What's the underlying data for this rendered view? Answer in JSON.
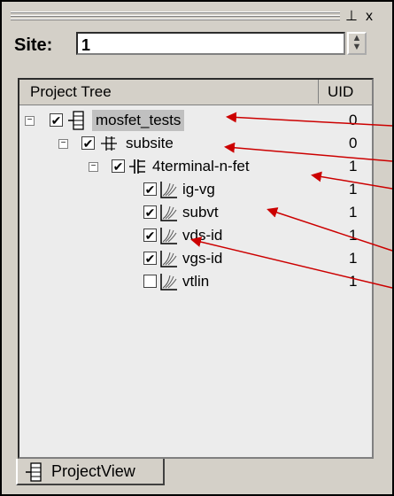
{
  "window": {
    "pin_glyph": "⊥",
    "close_glyph": "x"
  },
  "site": {
    "label": "Site:",
    "value": "1"
  },
  "tree": {
    "columns": {
      "project": "Project Tree",
      "uid": "UID"
    },
    "rows": [
      {
        "label": "mosfet_tests",
        "uid": "0",
        "checked": true,
        "icon": "project-icon",
        "expander": "−"
      },
      {
        "label": "subsite",
        "uid": "0",
        "checked": true,
        "icon": "subsite-icon",
        "expander": "−"
      },
      {
        "label": "4terminal-n-fet",
        "uid": "1",
        "checked": true,
        "icon": "device-icon",
        "expander": "−"
      },
      {
        "label": "ig-vg",
        "uid": "1",
        "checked": true,
        "icon": "test-icon"
      },
      {
        "label": "subvt",
        "uid": "1",
        "checked": true,
        "icon": "test-icon"
      },
      {
        "label": "vds-id",
        "uid": "1",
        "checked": true,
        "icon": "test-icon"
      },
      {
        "label": "vgs-id",
        "uid": "1",
        "checked": true,
        "icon": "test-icon"
      },
      {
        "label": "vtlin",
        "uid": "1",
        "checked": false,
        "icon": "test-icon"
      }
    ]
  },
  "tabs": {
    "project_view": "ProjectView"
  },
  "colors": {
    "annotation_arrow": "#cc0000",
    "panel": "#d4d0c8"
  }
}
